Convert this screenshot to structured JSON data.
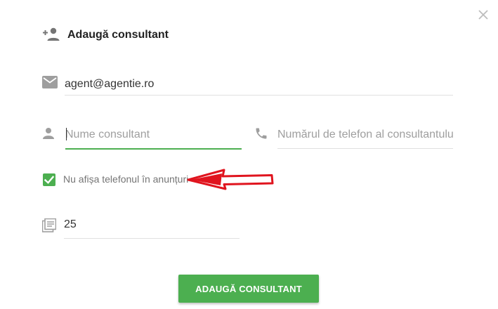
{
  "dialog": {
    "title": "Adaugă consultant",
    "close_icon": "close-icon",
    "header_icon": "person-add-icon"
  },
  "form": {
    "email": {
      "value": "agent@agentie.ro",
      "icon": "mail-icon"
    },
    "name": {
      "value": "",
      "placeholder": "Nume consultant",
      "icon": "person-icon"
    },
    "phone": {
      "value": "",
      "placeholder": "Numărul de telefon al consultantului",
      "icon": "phone-icon"
    },
    "hide_phone": {
      "checked": true,
      "label": "Nu afișa telefonul în anunțuri"
    },
    "listings": {
      "value": "25",
      "icon": "listings-icon"
    }
  },
  "submit_label": "ADAUGĂ CONSULTANT",
  "colors": {
    "accent": "#4caf50",
    "icon": "#9e9e9e",
    "divider": "#e0e0e0",
    "annotation_arrow": "#e0141e"
  }
}
